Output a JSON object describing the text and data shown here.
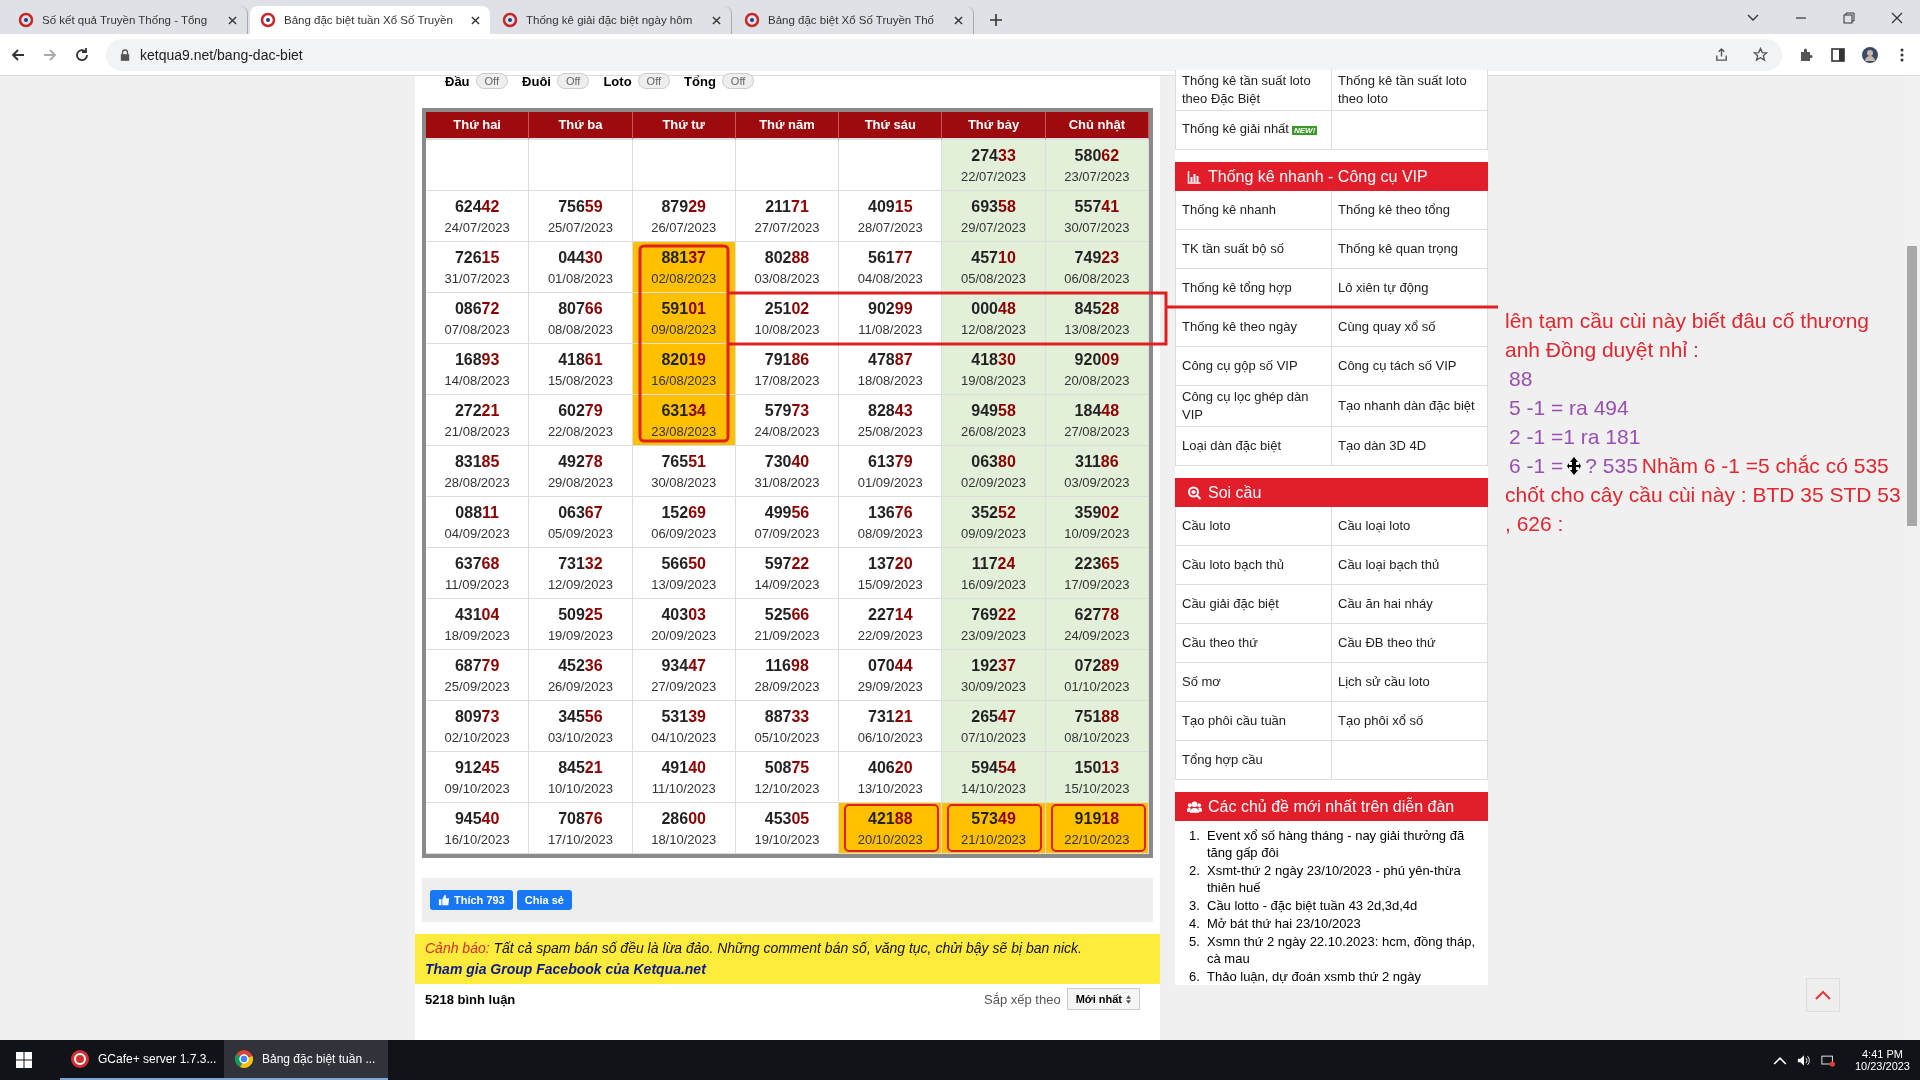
{
  "browser": {
    "tabs": [
      {
        "title": "Số kết quả Truyền Thống - Tổng",
        "selected": false
      },
      {
        "title": "Bảng đặc biệt tuần Xổ Số Truyền",
        "selected": true
      },
      {
        "title": "Thống kê giải đặc biệt ngày hôm",
        "selected": false
      },
      {
        "title": "Bảng đặc biệt Xổ Số Truyền Thố",
        "selected": false
      }
    ],
    "url": "ketqua9.net/bang-dac-biet"
  },
  "filters": [
    {
      "label": "Đầu",
      "toggle": "Off"
    },
    {
      "label": "Đuôi",
      "toggle": "Off"
    },
    {
      "label": "Loto",
      "toggle": "Off"
    },
    {
      "label": "Tổng",
      "toggle": "Off"
    }
  ],
  "table": {
    "columns": [
      "Thứ hai",
      "Thứ ba",
      "Thứ tư",
      "Thứ năm",
      "Thứ sáu",
      "Thứ bảy",
      "Chủ nhật"
    ],
    "rows": [
      [
        null,
        null,
        null,
        null,
        null,
        {
          "number": "27433",
          "date": "22/07/2023",
          "kind": "weekend"
        },
        {
          "number": "58062",
          "date": "23/07/2023",
          "kind": "weekend"
        }
      ],
      [
        {
          "number": "62442",
          "date": "24/07/2023",
          "kind": "plain"
        },
        {
          "number": "75659",
          "date": "25/07/2023",
          "kind": "plain"
        },
        {
          "number": "87929",
          "date": "26/07/2023",
          "kind": "plain"
        },
        {
          "number": "21171",
          "date": "27/07/2023",
          "kind": "plain"
        },
        {
          "number": "40915",
          "date": "28/07/2023",
          "kind": "plain"
        },
        {
          "number": "69358",
          "date": "29/07/2023",
          "kind": "weekend"
        },
        {
          "number": "55741",
          "date": "30/07/2023",
          "kind": "weekend"
        }
      ],
      [
        {
          "number": "72615",
          "date": "31/07/2023",
          "kind": "plain"
        },
        {
          "number": "04430",
          "date": "01/08/2023",
          "kind": "plain"
        },
        {
          "number": "88137",
          "date": "02/08/2023",
          "kind": "marked"
        },
        {
          "number": "80288",
          "date": "03/08/2023",
          "kind": "plain"
        },
        {
          "number": "56177",
          "date": "04/08/2023",
          "kind": "plain"
        },
        {
          "number": "45710",
          "date": "05/08/2023",
          "kind": "weekend"
        },
        {
          "number": "74923",
          "date": "06/08/2023",
          "kind": "weekend"
        }
      ],
      [
        {
          "number": "08672",
          "date": "07/08/2023",
          "kind": "plain"
        },
        {
          "number": "80766",
          "date": "08/08/2023",
          "kind": "plain"
        },
        {
          "number": "59101",
          "date": "09/08/2023",
          "kind": "marked"
        },
        {
          "number": "25102",
          "date": "10/08/2023",
          "kind": "plain"
        },
        {
          "number": "90299",
          "date": "11/08/2023",
          "kind": "plain"
        },
        {
          "number": "00048",
          "date": "12/08/2023",
          "kind": "weekend"
        },
        {
          "number": "84528",
          "date": "13/08/2023",
          "kind": "weekend"
        }
      ],
      [
        {
          "number": "16893",
          "date": "14/08/2023",
          "kind": "plain"
        },
        {
          "number": "41861",
          "date": "15/08/2023",
          "kind": "plain"
        },
        {
          "number": "82019",
          "date": "16/08/2023",
          "kind": "marked"
        },
        {
          "number": "79186",
          "date": "17/08/2023",
          "kind": "plain"
        },
        {
          "number": "47887",
          "date": "18/08/2023",
          "kind": "plain"
        },
        {
          "number": "41830",
          "date": "19/08/2023",
          "kind": "weekend"
        },
        {
          "number": "92009",
          "date": "20/08/2023",
          "kind": "weekend"
        }
      ],
      [
        {
          "number": "27221",
          "date": "21/08/2023",
          "kind": "plain"
        },
        {
          "number": "60279",
          "date": "22/08/2023",
          "kind": "plain"
        },
        {
          "number": "63134",
          "date": "23/08/2023",
          "kind": "marked"
        },
        {
          "number": "57973",
          "date": "24/08/2023",
          "kind": "plain"
        },
        {
          "number": "82843",
          "date": "25/08/2023",
          "kind": "plain"
        },
        {
          "number": "94958",
          "date": "26/08/2023",
          "kind": "weekend"
        },
        {
          "number": "18448",
          "date": "27/08/2023",
          "kind": "weekend"
        }
      ],
      [
        {
          "number": "83185",
          "date": "28/08/2023",
          "kind": "plain"
        },
        {
          "number": "49278",
          "date": "29/08/2023",
          "kind": "plain"
        },
        {
          "number": "76551",
          "date": "30/08/2023",
          "kind": "plain"
        },
        {
          "number": "73040",
          "date": "31/08/2023",
          "kind": "plain"
        },
        {
          "number": "61379",
          "date": "01/09/2023",
          "kind": "plain"
        },
        {
          "number": "06380",
          "date": "02/09/2023",
          "kind": "weekend"
        },
        {
          "number": "31186",
          "date": "03/09/2023",
          "kind": "weekend"
        }
      ],
      [
        {
          "number": "08811",
          "date": "04/09/2023",
          "kind": "plain"
        },
        {
          "number": "06367",
          "date": "05/09/2023",
          "kind": "plain"
        },
        {
          "number": "15269",
          "date": "06/09/2023",
          "kind": "plain"
        },
        {
          "number": "49956",
          "date": "07/09/2023",
          "kind": "plain"
        },
        {
          "number": "13676",
          "date": "08/09/2023",
          "kind": "plain"
        },
        {
          "number": "35252",
          "date": "09/09/2023",
          "kind": "weekend"
        },
        {
          "number": "35902",
          "date": "10/09/2023",
          "kind": "weekend"
        }
      ],
      [
        {
          "number": "63768",
          "date": "11/09/2023",
          "kind": "plain"
        },
        {
          "number": "73132",
          "date": "12/09/2023",
          "kind": "plain"
        },
        {
          "number": "56650",
          "date": "13/09/2023",
          "kind": "plain"
        },
        {
          "number": "59722",
          "date": "14/09/2023",
          "kind": "plain"
        },
        {
          "number": "13720",
          "date": "15/09/2023",
          "kind": "plain"
        },
        {
          "number": "11724",
          "date": "16/09/2023",
          "kind": "weekend"
        },
        {
          "number": "22365",
          "date": "17/09/2023",
          "kind": "weekend"
        }
      ],
      [
        {
          "number": "43104",
          "date": "18/09/2023",
          "kind": "plain"
        },
        {
          "number": "50925",
          "date": "19/09/2023",
          "kind": "plain"
        },
        {
          "number": "40303",
          "date": "20/09/2023",
          "kind": "plain"
        },
        {
          "number": "52566",
          "date": "21/09/2023",
          "kind": "plain"
        },
        {
          "number": "22714",
          "date": "22/09/2023",
          "kind": "plain"
        },
        {
          "number": "76922",
          "date": "23/09/2023",
          "kind": "weekend"
        },
        {
          "number": "62778",
          "date": "24/09/2023",
          "kind": "weekend"
        }
      ],
      [
        {
          "number": "68779",
          "date": "25/09/2023",
          "kind": "plain"
        },
        {
          "number": "45236",
          "date": "26/09/2023",
          "kind": "plain"
        },
        {
          "number": "93447",
          "date": "27/09/2023",
          "kind": "plain"
        },
        {
          "number": "11698",
          "date": "28/09/2023",
          "kind": "plain"
        },
        {
          "number": "07044",
          "date": "29/09/2023",
          "kind": "plain"
        },
        {
          "number": "19237",
          "date": "30/09/2023",
          "kind": "weekend"
        },
        {
          "number": "07289",
          "date": "01/10/2023",
          "kind": "weekend"
        }
      ],
      [
        {
          "number": "80973",
          "date": "02/10/2023",
          "kind": "plain"
        },
        {
          "number": "34556",
          "date": "03/10/2023",
          "kind": "plain"
        },
        {
          "number": "53139",
          "date": "04/10/2023",
          "kind": "plain"
        },
        {
          "number": "88733",
          "date": "05/10/2023",
          "kind": "plain"
        },
        {
          "number": "73121",
          "date": "06/10/2023",
          "kind": "plain"
        },
        {
          "number": "26547",
          "date": "07/10/2023",
          "kind": "weekend"
        },
        {
          "number": "75188",
          "date": "08/10/2023",
          "kind": "weekend"
        }
      ],
      [
        {
          "number": "91245",
          "date": "09/10/2023",
          "kind": "plain"
        },
        {
          "number": "84521",
          "date": "10/10/2023",
          "kind": "plain"
        },
        {
          "number": "49140",
          "date": "11/10/2023",
          "kind": "plain"
        },
        {
          "number": "50875",
          "date": "12/10/2023",
          "kind": "plain"
        },
        {
          "number": "40620",
          "date": "13/10/2023",
          "kind": "plain"
        },
        {
          "number": "59454",
          "date": "14/10/2023",
          "kind": "weekend"
        },
        {
          "number": "15013",
          "date": "15/10/2023",
          "kind": "weekend"
        }
      ],
      [
        {
          "number": "94540",
          "date": "16/10/2023",
          "kind": "plain"
        },
        {
          "number": "70876",
          "date": "17/10/2023",
          "kind": "plain"
        },
        {
          "number": "28600",
          "date": "18/10/2023",
          "kind": "plain"
        },
        {
          "number": "45305",
          "date": "19/10/2023",
          "kind": "plain"
        },
        {
          "number": "42188",
          "date": "20/10/2023",
          "kind": "marked"
        },
        {
          "number": "57349",
          "date": "21/10/2023",
          "kind": "marked"
        },
        {
          "number": "91918",
          "date": "22/10/2023",
          "kind": "marked"
        }
      ]
    ]
  },
  "social": {
    "like": "Thích 793",
    "share": "Chia sẻ"
  },
  "warning": {
    "label": "Cảnh báo:",
    "text": "Tất cả spam bán số đều là lừa đảo. Những comment bán số, văng tục, chửi bậy sẽ bị ban nick.",
    "link": "Tham gia Group Facebook của Ketqua.net"
  },
  "comments": {
    "count": "5218 bình luận",
    "sort_label": "Sắp xếp theo",
    "sort_value": "Mới nhất"
  },
  "sidebar": {
    "top_rows": [
      [
        {
          "text": "Thống kê tần suất loto theo Đặc Biệt"
        },
        {
          "text": "Thống kê tần suất loto theo loto"
        }
      ],
      [
        {
          "text": "Thống kê giải nhất",
          "badge": "NEW!"
        }
      ]
    ],
    "sections": [
      {
        "title": "Thống kê nhanh - Công cụ VIP",
        "kind": "links",
        "rows": [
          [
            "Thống kê nhanh",
            "Thống kê theo tổng"
          ],
          [
            "TK tần suất bộ số",
            "Thống kê quan trọng"
          ],
          [
            "Thống kê tổng hợp",
            "Lô xiên tự động"
          ],
          [
            "Thống kê theo ngày",
            "Cùng quay xổ số"
          ],
          [
            "Công cụ gộp số VIP",
            "Công cụ tách số VIP"
          ],
          [
            "Công cụ lọc ghép dàn VIP",
            "Tạo nhanh dàn đặc biệt"
          ],
          [
            "Loại dàn đặc biệt",
            "Tạo dàn 3D 4D"
          ]
        ]
      },
      {
        "title": "Soi cầu",
        "kind": "links",
        "rows": [
          [
            "Cầu loto",
            "Cầu loại loto"
          ],
          [
            "Cầu loto bạch thủ",
            "Cầu loại bạch thủ"
          ],
          [
            "Cầu giải đặc biệt",
            "Cầu ăn hai nháy"
          ],
          [
            "Cầu theo thứ",
            "Cầu ĐB theo thứ"
          ],
          [
            "Số mơ",
            "Lịch sử cầu loto"
          ],
          [
            "Tạo phôi cầu tuần",
            "Tạo phôi xổ số"
          ],
          [
            "Tổng hợp cầu"
          ]
        ]
      },
      {
        "title": "Các chủ đề mới nhất trên diễn đàn",
        "kind": "list",
        "items": [
          {
            "num": "1.",
            "text": "Event xổ số hàng tháng - nay giải thưởng đã tăng gấp đôi"
          },
          {
            "num": "2.",
            "text": "Xsmt-thứ 2 ngày 23/10/2023 - phú yên-thừa thiên huế"
          },
          {
            "num": "3.",
            "text": "Cầu lotto - đặc biệt tuần 43 2d,3d,4d"
          },
          {
            "num": "4.",
            "text": "Mở bát thứ hai 23/10/2023"
          },
          {
            "num": "5.",
            "text": "Xsmn thứ 2 ngày 22.10.2023: hcm, đồng tháp, cà mau"
          },
          {
            "num": "6.",
            "text": "Thảo luận, dự đoán xsmb thứ 2 ngày"
          }
        ]
      }
    ]
  },
  "annotation": {
    "lines": [
      {
        "parts": [
          {
            "text": "lên tạm cầu cùi này biết đâu cố thương anh Đồng duyệt nhỉ :",
            "color": "#e0262e"
          }
        ]
      },
      {
        "parts": [
          {
            "text": "88",
            "color": "#9a4fb2"
          }
        ]
      },
      {
        "parts": [
          {
            "text": "5 -1 =   ra 494",
            "color": "#9a4fb2"
          }
        ]
      },
      {
        "parts": [
          {
            "text": "2 -1 =1 ra 181",
            "color": "#9a4fb2"
          }
        ]
      },
      {
        "parts": [
          {
            "text": "6 -1 =",
            "color": "#9a4fb2"
          },
          {
            "text": "? 535",
            "color": "#9a4fb2",
            "cursor": true
          },
          {
            "text": "Nhầm 6 -1 =5 chắc có 535",
            "color": "#e0262e"
          }
        ]
      },
      {
        "parts": [
          {
            "text": "chốt cho cây cầu cùi này : BTD 35 STD 53 , 626 :",
            "color": "#e0262e"
          }
        ]
      }
    ]
  },
  "taskbar": {
    "apps": [
      {
        "label": "GCafe+ server 1.7.3...",
        "selected": false
      },
      {
        "label": "Bảng đặc biệt tuần ...",
        "selected": true
      }
    ],
    "time": "4:41 PM",
    "date": "10/23/2023"
  }
}
